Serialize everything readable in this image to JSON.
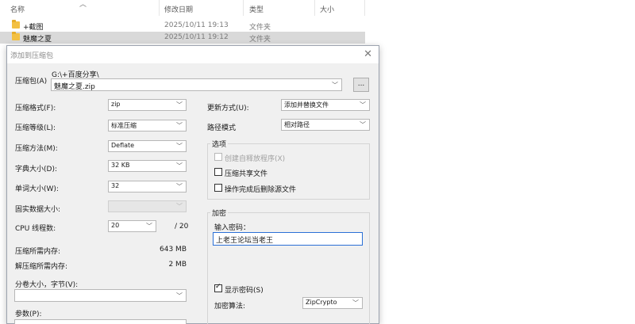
{
  "explorer": {
    "columns": {
      "name": "名称",
      "modified": "修改日期",
      "type": "类型",
      "size": "大小"
    },
    "rows": [
      {
        "name": "+截图",
        "modified": "2025/10/11 19:13",
        "type": "文件夹"
      },
      {
        "name": "魅魔之夏",
        "modified": "2025/10/11 19:12",
        "type": "文件夹"
      }
    ]
  },
  "dialog": {
    "title": "添加到压缩包",
    "archive": {
      "label": "压缩包(A)",
      "path": "G:\\+百度分享\\",
      "filename": "魅魔之夏.zip",
      "browse_label": "..."
    },
    "left": {
      "format": {
        "label": "压缩格式(F):",
        "value": "zip"
      },
      "level": {
        "label": "压缩等级(L):",
        "value": "标准压缩"
      },
      "method": {
        "label": "压缩方法(M):",
        "value": "Deflate"
      },
      "dict": {
        "label": "字典大小(D):",
        "value": "32 KB"
      },
      "word": {
        "label": "单词大小(W):",
        "value": "32"
      },
      "solid": {
        "label": "固实数据大小:",
        "value": ""
      },
      "threads": {
        "label": "CPU 线程数:",
        "value": "20",
        "max": "/ 20"
      },
      "mem_compress": {
        "label": "压缩所需内存:",
        "value": "643 MB"
      },
      "mem_decompress": {
        "label": "解压缩所需内存:",
        "value": "2 MB"
      },
      "split": {
        "label": "分卷大小，字节(V):",
        "value": ""
      },
      "params": {
        "label": "参数(P):"
      }
    },
    "right": {
      "update": {
        "label": "更新方式(U):",
        "value": "添加并替换文件"
      },
      "path_mode": {
        "label": "路径模式",
        "value": "相对路径"
      },
      "options": {
        "title": "选项",
        "sfx": "创建自释放程序(X)",
        "shared": "压缩共享文件",
        "delete_after": "操作完成后删除源文件"
      },
      "encryption": {
        "title": "加密",
        "password_label": "输入密码：",
        "password": "上老王论坛当老王",
        "show_password": "显示密码(S)",
        "algo_label": "加密算法:",
        "algo_value": "ZipCrypto"
      }
    }
  }
}
